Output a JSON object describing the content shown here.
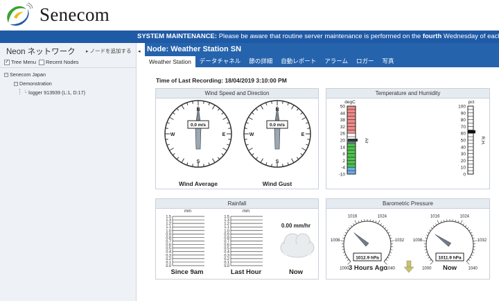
{
  "brand": "Senecom",
  "maintenance": {
    "label": "SYSTEM MAINTENANCE:",
    "text_before": " Please be aware that routine server maintenance is performed on the ",
    "emphasis": "fourth",
    "text_after": " Wednesday of each month starting at"
  },
  "sidebar": {
    "title": "Neon ネットワーク",
    "add_node": "ノードを追加する",
    "tree_menu": "Tree Menu",
    "recent_nodes": "Recent Nodes",
    "tree": [
      "Senecom Japan",
      "Demonstration",
      "logger 913939 (L:1, D:17)"
    ]
  },
  "node_title": "Node: Weather Station SN",
  "tabs": [
    "Weather Station",
    "データチャネル",
    "節の詳細",
    "自動レポート",
    "アラーム",
    "ロガー",
    "写真"
  ],
  "recording": "Time of Last Recording: 18/04/2019 3:10:00 PM",
  "wind": {
    "title": "Wind Speed and Direction",
    "average": {
      "label": "Wind Average",
      "value": "0.0 m/s",
      "direction_deg": 0
    },
    "gust": {
      "label": "Wind Gust",
      "value": "0.0 m/s",
      "direction_deg": 0
    },
    "compass": [
      "N",
      "E",
      "S",
      "W"
    ]
  },
  "temp": {
    "title": "Temperature and Humidity",
    "temp_unit": "degC",
    "temp_ticks": [
      "50",
      "44",
      "38",
      "32",
      "26",
      "20",
      "14",
      "8",
      "2",
      "-4",
      "-10"
    ],
    "temp_value": 20,
    "temp_label": "Air",
    "rh_unit": "pct",
    "rh_ticks": [
      "100",
      "90",
      "80",
      "70",
      "60",
      "50",
      "40",
      "30",
      "20",
      "10",
      "0"
    ],
    "rh_value": 62,
    "rh_label": "R.H.",
    "colors": {
      "hot": "#f08a8a",
      "warm": "#ffffff",
      "mild": "#4cc14c",
      "cold": "#6ab0e8"
    }
  },
  "rain": {
    "title": "Rainfall",
    "unit": "mm",
    "ticks": [
      "1.5",
      "1.3",
      "1.2",
      "1.1",
      "1.0",
      "0.9",
      "0.8",
      "0.7",
      "0.6",
      "0.5",
      "0.4",
      "0.3",
      "0.2",
      "0.1",
      "0.0"
    ],
    "since9": {
      "label": "Since 9am",
      "value": 0
    },
    "last_hour": {
      "label": "Last Hour",
      "value": 0
    },
    "rate": "0.00 mm/hr",
    "now": "Now"
  },
  "baro": {
    "title": "Barometric Pressure",
    "ticks": [
      "1000",
      "1008",
      "1016",
      "1024",
      "1032",
      "1040"
    ],
    "past": {
      "value": 1012.9,
      "readout": "1012.9 hPa",
      "label": "3 Hours Ago"
    },
    "now": {
      "value": 1011.9,
      "readout": "1011.9 hPa",
      "label": "Now"
    }
  }
}
